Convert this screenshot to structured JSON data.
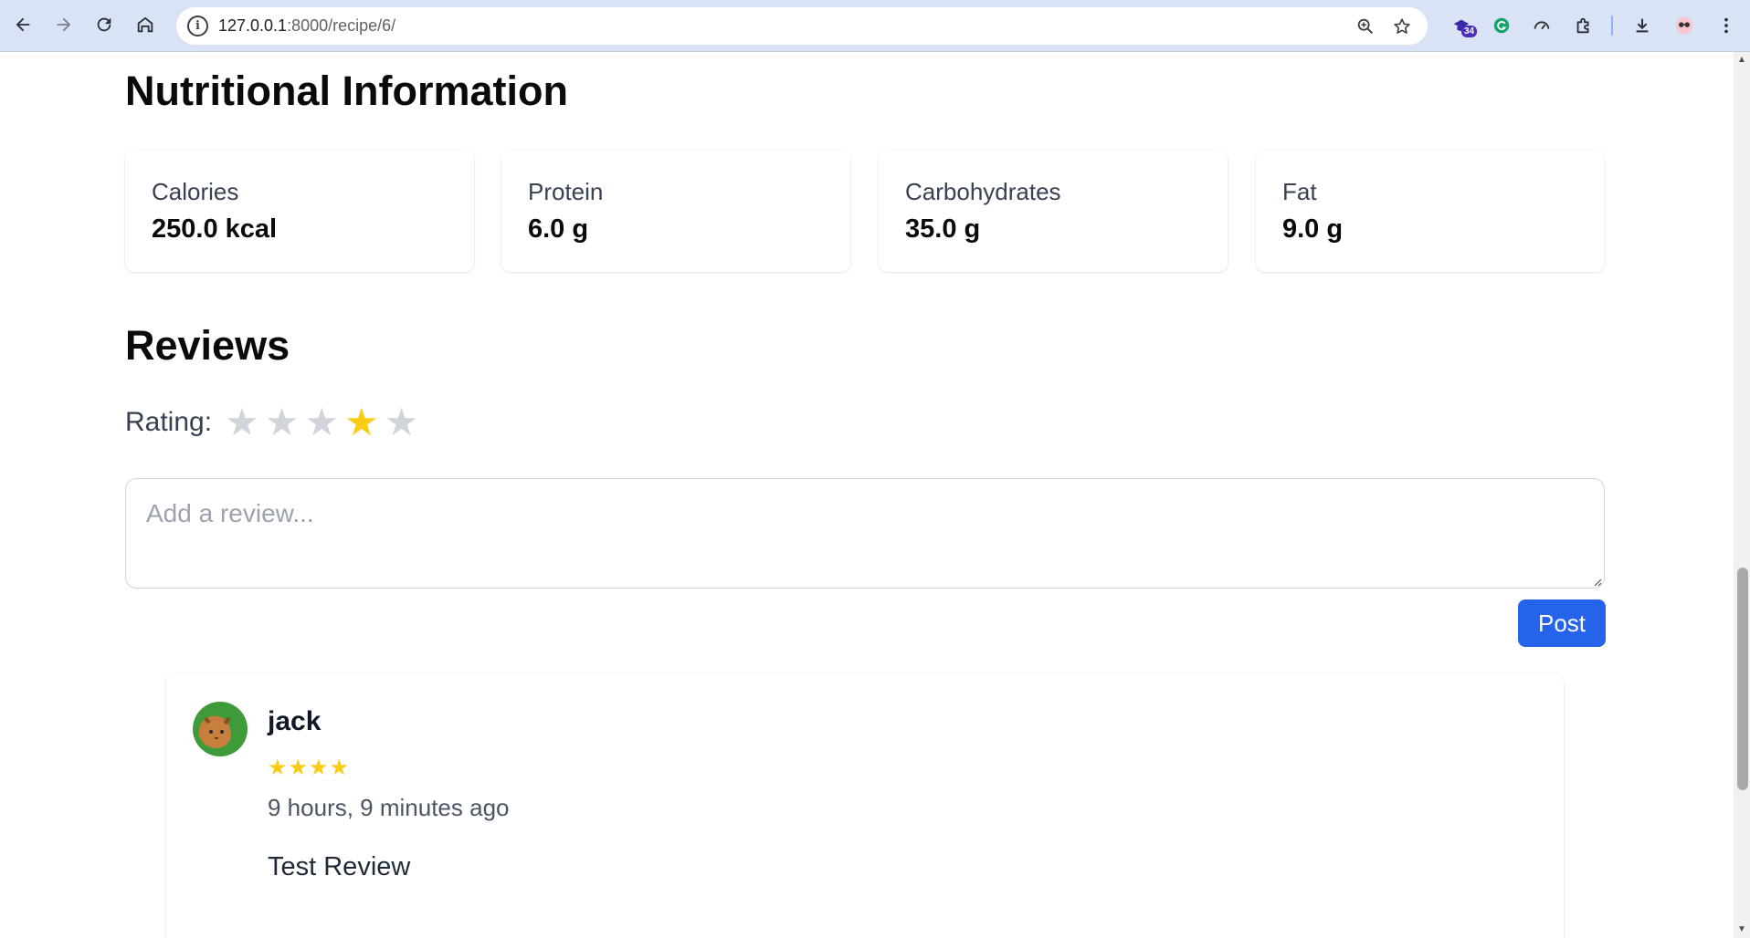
{
  "browser": {
    "url_host": "127.0.0.1",
    "url_path": ":8000/recipe/6/",
    "extension_badge": "34"
  },
  "page": {
    "nutrition_title": "Nutritional Information",
    "nutrition": [
      {
        "label": "Calories",
        "value": "250.0 kcal"
      },
      {
        "label": "Protein",
        "value": "6.0 g"
      },
      {
        "label": "Carbohydrates",
        "value": "35.0 g"
      },
      {
        "label": "Fat",
        "value": "9.0 g"
      }
    ],
    "reviews_title": "Reviews",
    "rating_label": "Rating:",
    "rating_selected": 4,
    "rating_max": 5,
    "review_placeholder": "Add a review...",
    "post_label": "Post",
    "reviews": [
      {
        "author": "jack",
        "stars": "★★★★",
        "time": "9 hours, 9 minutes ago",
        "text": "Test Review"
      }
    ]
  },
  "colors": {
    "accent": "#2563eb",
    "star_active": "#facc15",
    "star_inactive": "#d1d5db"
  },
  "icons": [
    "back-icon",
    "forward-icon",
    "reload-icon",
    "home-icon",
    "info-icon",
    "zoom-icon",
    "bookmark-star-icon",
    "extension-icon",
    "grammarly-icon",
    "speed-icon",
    "puzzle-icon",
    "download-icon",
    "profile-icon",
    "menu-icon"
  ]
}
